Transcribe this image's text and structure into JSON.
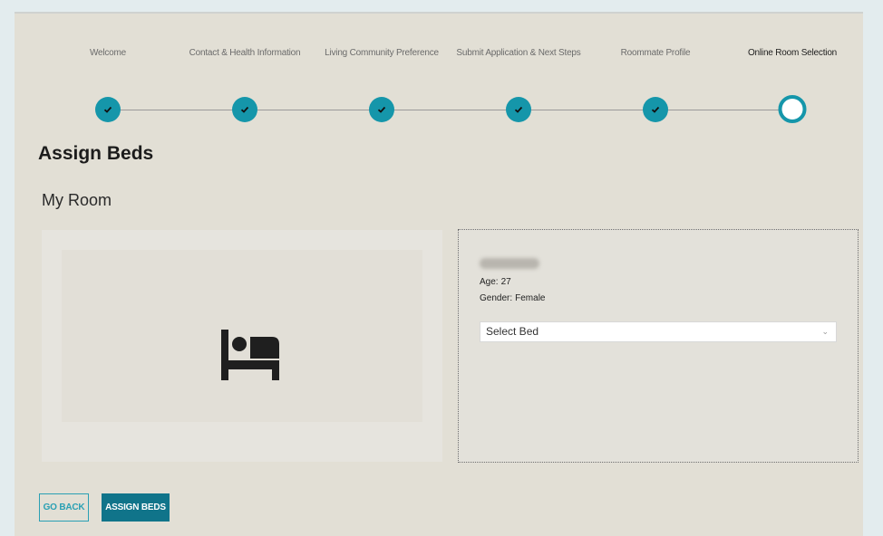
{
  "steps": [
    {
      "label": "Welcome",
      "status": "complete"
    },
    {
      "label": "Contact & Health Information",
      "status": "complete"
    },
    {
      "label": "Living Community Preference",
      "status": "complete"
    },
    {
      "label": "Submit Application & Next Steps",
      "status": "complete"
    },
    {
      "label": "Roommate Profile",
      "status": "complete"
    },
    {
      "label": "Online Room Selection",
      "status": "current"
    }
  ],
  "page": {
    "title": "Assign Beds",
    "section_title": "My Room"
  },
  "roommate": {
    "age_label": "Age:",
    "age": "27",
    "gender_label": "Gender:",
    "gender": "Female",
    "bed_select_value": "Select Bed"
  },
  "icons": {
    "room_image": "bed-icon",
    "step_complete": "check-icon",
    "select_caret": "chevron-down-icon"
  },
  "buttons": {
    "back": "Go Back",
    "assign": "Assign Beds"
  },
  "colors": {
    "accent": "#1596aa",
    "primary_button": "#10748a",
    "panel_bg": "#e2dfd5"
  }
}
